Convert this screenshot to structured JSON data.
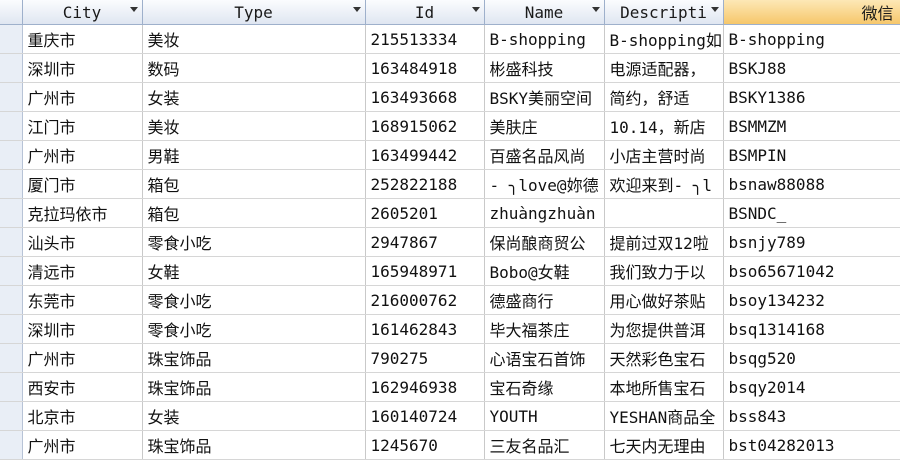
{
  "headers": [
    "City",
    "Type",
    "Id",
    "Name",
    "Descripti",
    "微信"
  ],
  "rows": [
    [
      "重庆市",
      "美妆",
      "215513334",
      "B-shopping",
      "B-shopping如",
      "B-shopping"
    ],
    [
      "深圳市",
      "数码",
      "163484918",
      "彬盛科技",
      "电源适配器，",
      "BSKJ88"
    ],
    [
      "广州市",
      "女装",
      "163493668",
      "BSKY美丽空间",
      "  简约，舒适",
      "BSKY1386"
    ],
    [
      "江门市",
      "美妆",
      "168915062",
      "美肤庄",
      "10.14，新店",
      "BSMMZM"
    ],
    [
      "广州市",
      "男鞋",
      "163499442",
      "百盛名品风尚",
      "小店主营时尚",
      "BSMPIN"
    ],
    [
      "厦门市",
      "箱包",
      "252822188",
      "- ╮love@妳德",
      "欢迎来到- ╮l",
      "bsnaw88088"
    ],
    [
      "克拉玛依市",
      "箱包",
      "2605201",
      "zhuàngzhuàn",
      "",
      "BSNDC_"
    ],
    [
      "汕头市",
      "零食小吃",
      "2947867",
      "保尚酿商贸公",
      "提前过双12啦",
      "bsnjy789"
    ],
    [
      "清远市",
      "女鞋",
      "165948971",
      "Bobo@女鞋",
      "我们致力于以",
      "bso65671042"
    ],
    [
      "东莞市",
      "零食小吃",
      "216000762",
      "德盛商行",
      "用心做好茶贴",
      "bsoy134232"
    ],
    [
      "深圳市",
      "零食小吃",
      "161462843",
      "毕大福茶庄",
      "为您提供普洱",
      "bsq1314168"
    ],
    [
      "广州市",
      "珠宝饰品",
      "790275",
      "心语宝石首饰",
      "天然彩色宝石",
      "bsqg520"
    ],
    [
      "西安市",
      "珠宝饰品",
      "162946938",
      "宝石奇缘",
      "本地所售宝石",
      "bsqy2014"
    ],
    [
      "北京市",
      "女装",
      "160140724",
      "YOUTH",
      "YESHAN商品全",
      "bss843"
    ],
    [
      "广州市",
      "珠宝饰品",
      "1245670",
      "三友名品汇",
      "七天内无理由",
      "bst04282013"
    ]
  ]
}
